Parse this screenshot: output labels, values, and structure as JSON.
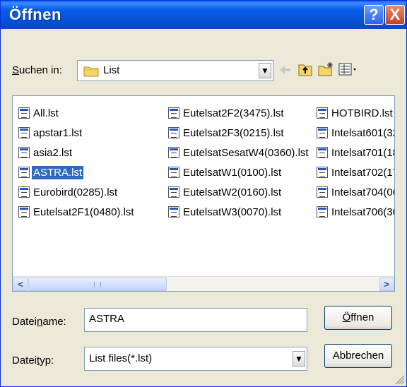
{
  "window": {
    "title": "Öffnen",
    "help_glyph": "?",
    "close_glyph": "X"
  },
  "lookin": {
    "label_prefix": "S",
    "label_rest": "uchen in:",
    "current_folder": "List",
    "icons": [
      "folder-icon",
      "back-arrow-icon",
      "up-folder-icon",
      "new-folder-icon",
      "view-menu-icon"
    ]
  },
  "files": [
    [
      "All.lst",
      "apstar1.lst",
      "asia2.lst",
      "ASTRA.lst",
      "Eurobird(0285).lst",
      "Eutelsat2F1(0480).lst"
    ],
    [
      "Eutelsat2F2(3475).lst",
      "Eutelsat2F3(0215).lst",
      "EutelsatSesatW4(0360).lst",
      "EutelsatW1(0100).lst",
      "EutelsatW2(0160).lst",
      "EutelsatW3(0070).lst"
    ],
    [
      "HOTBIRD.lst",
      "Intelsat601(32!",
      "Intelsat701(18(",
      "Intelsat702(17",
      "Intelsat704(06(",
      "Intelsat706(30"
    ]
  ],
  "selected_file": "ASTRA.lst",
  "filename": {
    "label_pre": "Datei",
    "label_u": "n",
    "label_post": "ame:",
    "value": "ASTRA"
  },
  "filetype": {
    "label_pre": "Datei",
    "label_u": "t",
    "label_post": "yp:",
    "value": "List files(*.lst)"
  },
  "buttons": {
    "open_u": "Ö",
    "open_rest": "ffnen",
    "cancel": "Abbrechen"
  },
  "colors": {
    "titlebar": "#0b5ee8",
    "selection": "#316ac5",
    "dialog_bg": "#ece9d8"
  }
}
